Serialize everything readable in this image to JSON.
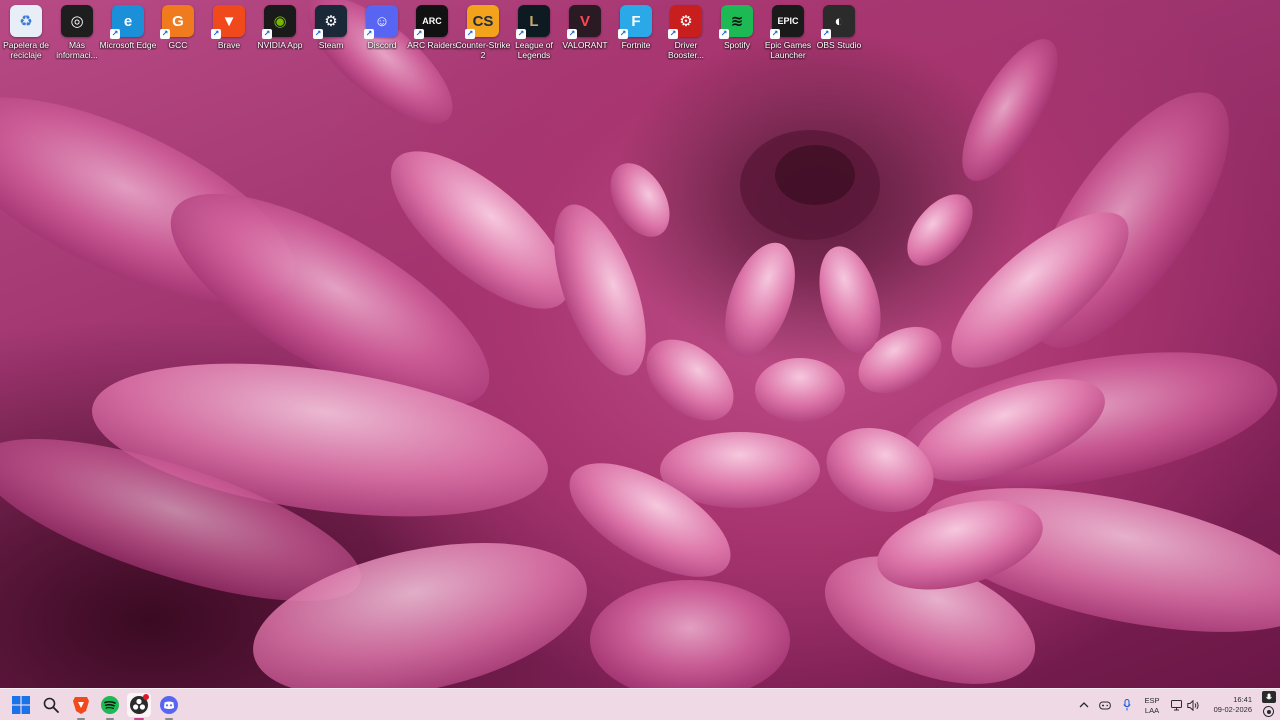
{
  "desktop": {
    "icons": [
      {
        "name": "recycle-bin",
        "label": "Papelera de reciclaje",
        "glyph": "♻",
        "color": "#e8eef7",
        "fg": "#3a78d8",
        "shortcut": false
      },
      {
        "name": "more-info",
        "label": "Más informaci...",
        "glyph": "◎",
        "color": "#1e1e1e",
        "fg": "#ffffff",
        "shortcut": false
      },
      {
        "name": "microsoft-edge",
        "label": "Microsoft Edge",
        "glyph": "e",
        "color": "#1b8fd8",
        "fg": "#ffffff",
        "shortcut": true
      },
      {
        "name": "gcc",
        "label": "GCC",
        "glyph": "G",
        "color": "#f07a1e",
        "fg": "#ffffff",
        "shortcut": true
      },
      {
        "name": "brave",
        "label": "Brave",
        "glyph": "▼",
        "color": "#f04a1c",
        "fg": "#ffffff",
        "shortcut": true
      },
      {
        "name": "nvidia-app",
        "label": "NVIDIA App",
        "glyph": "◉",
        "color": "#1a1a1a",
        "fg": "#76b900",
        "shortcut": true
      },
      {
        "name": "steam",
        "label": "Steam",
        "glyph": "⚙",
        "color": "#1b2838",
        "fg": "#ffffff",
        "shortcut": true
      },
      {
        "name": "discord",
        "label": "Discord",
        "glyph": "☺",
        "color": "#5865f2",
        "fg": "#ffffff",
        "shortcut": true
      },
      {
        "name": "arc-raiders",
        "label": "ARC Raiders",
        "glyph": "ARC",
        "color": "#111111",
        "fg": "#ffffff",
        "shortcut": true
      },
      {
        "name": "counter-strike-2",
        "label": "Counter-Strike 2",
        "glyph": "CS",
        "color": "#f2a21b",
        "fg": "#1b2a4a",
        "shortcut": true
      },
      {
        "name": "league-of-legends",
        "label": "League of Legends",
        "glyph": "L",
        "color": "#0e1a22",
        "fg": "#c8aa6e",
        "shortcut": true
      },
      {
        "name": "valorant",
        "label": "VALORANT",
        "glyph": "V",
        "color": "#2a1a24",
        "fg": "#ff4655",
        "shortcut": true
      },
      {
        "name": "fortnite",
        "label": "Fortnite",
        "glyph": "F",
        "color": "#2aa8e8",
        "fg": "#ffffff",
        "shortcut": true
      },
      {
        "name": "driver-booster",
        "label": "Driver Booster...",
        "glyph": "⚙",
        "color": "#c81e1e",
        "fg": "#ffffff",
        "shortcut": true
      },
      {
        "name": "spotify",
        "label": "Spotify",
        "glyph": "≋",
        "color": "#1db954",
        "fg": "#111111",
        "shortcut": true
      },
      {
        "name": "epic-games-launcher",
        "label": "Epic Games Launcher",
        "glyph": "EPIC",
        "color": "#1a1a1a",
        "fg": "#ffffff",
        "shortcut": true
      },
      {
        "name": "obs-studio",
        "label": "OBS Studio",
        "glyph": "◐",
        "color": "#2b2b2b",
        "fg": "#ffffff",
        "shortcut": true
      }
    ]
  },
  "taskbar": {
    "apps": [
      {
        "name": "start-button",
        "glyph": "start",
        "active": false
      },
      {
        "name": "search-button",
        "glyph": "search",
        "active": false
      },
      {
        "name": "brave-taskbar",
        "glyph": "brave",
        "active": false
      },
      {
        "name": "spotify-taskbar",
        "glyph": "spotify",
        "active": false
      },
      {
        "name": "obs-taskbar",
        "glyph": "obs",
        "active": true
      },
      {
        "name": "discord-taskbar",
        "glyph": "discord",
        "active": false
      }
    ],
    "tray": {
      "language_top": "ESP",
      "language_bottom": "LAA",
      "time": "16:41",
      "date": "09-02-2026"
    }
  },
  "colors": {
    "accent": "#c84a8a",
    "taskbar_bg": "#f5e2ec"
  }
}
